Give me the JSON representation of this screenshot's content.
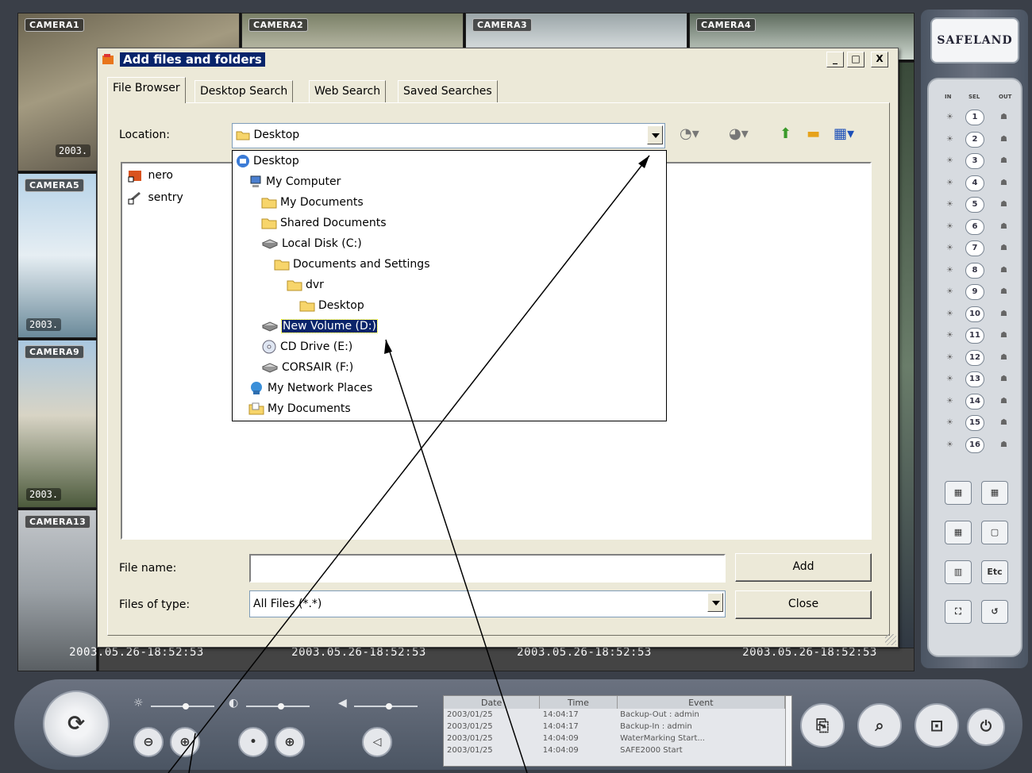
{
  "dvr": {
    "cameras": [
      {
        "label": "CAMERA1"
      },
      {
        "label": "CAMERA2"
      },
      {
        "label": "CAMERA3"
      },
      {
        "label": "CAMERA4"
      },
      {
        "label": "CAMERA5"
      },
      {
        "label": "CAMERA9"
      },
      {
        "label": "CAMERA13"
      }
    ],
    "left_stamps": [
      "2003.",
      "2003.",
      "2003."
    ],
    "timestamps": [
      "2003.05.26-18:52:53",
      "2003.05.26-18:52:53",
      "2003.05.26-18:52:53",
      "2003.05.26-18:52:53"
    ],
    "logo": "SAFELAND",
    "channels": {
      "header_in": "IN",
      "header_mid": "SEL",
      "header_out": "OUT",
      "numbers": [
        "1",
        "2",
        "3",
        "4",
        "5",
        "6",
        "7",
        "8",
        "9",
        "10",
        "11",
        "12",
        "13",
        "14",
        "15",
        "16"
      ]
    },
    "layout_buttons": [
      "",
      "",
      "",
      "",
      "",
      "Etc",
      "",
      ""
    ],
    "event_log": {
      "headers": [
        "Date",
        "Time",
        "Event"
      ],
      "rows": [
        [
          "2003/01/25",
          "14:04:17",
          "Backup-Out : admin"
        ],
        [
          "2003/01/25",
          "14:04:17",
          "Backup-In : admin"
        ],
        [
          "2003/01/25",
          "14:04:09",
          "WaterMarking Start..."
        ],
        [
          "2003/01/25",
          "14:04:09",
          "SAFE2000 Start"
        ]
      ]
    }
  },
  "dialog": {
    "title": "Add files and folders",
    "tabs": [
      "File Browser",
      "Desktop Search",
      "Web Search",
      "Saved Searches"
    ],
    "active_tab": "File Browser",
    "location_label": "Location:",
    "location_value": "Desktop",
    "files": [
      {
        "name": "nero",
        "icon": "nero-shortcut-icon"
      },
      {
        "name": "sentry",
        "icon": "sentry-shortcut-icon"
      }
    ],
    "dropdown_items": [
      {
        "label": "Desktop",
        "icon": "desktop-icon",
        "level": 0
      },
      {
        "label": "My Computer",
        "icon": "computer-icon",
        "level": 1
      },
      {
        "label": "My Documents",
        "icon": "folder-icon",
        "level": 2
      },
      {
        "label": "Shared Documents",
        "icon": "folder-icon",
        "level": 2
      },
      {
        "label": "Local Disk (C:)",
        "icon": "hard-drive-icon",
        "level": 2
      },
      {
        "label": "Documents and Settings",
        "icon": "folder-icon",
        "level": 3
      },
      {
        "label": "dvr",
        "icon": "folder-icon",
        "level": 4
      },
      {
        "label": "Desktop",
        "icon": "folder-icon",
        "level": 5
      },
      {
        "label": "New Volume (D:)",
        "icon": "hard-drive-icon",
        "level": 2,
        "selected": true
      },
      {
        "label": "CD Drive (E:)",
        "icon": "cd-drive-icon",
        "level": 2
      },
      {
        "label": "CORSAIR (F:)",
        "icon": "removable-drive-icon",
        "level": 2
      },
      {
        "label": "My Network Places",
        "icon": "network-places-icon",
        "level": 1
      },
      {
        "label": "My Documents",
        "icon": "my-documents-icon",
        "level": 1
      }
    ],
    "file_name_label": "File name:",
    "file_name_value": "",
    "files_of_type_label": "Files of type:",
    "files_of_type_value": "All Files (*.*)",
    "add_button": "Add",
    "close_button": "Close",
    "window_buttons": {
      "minimize": "_",
      "maximize": "□",
      "close": "X"
    }
  },
  "colors": {
    "selection": "#0a246a",
    "dialog_face": "#ece9d8",
    "title_highlight": "#08246b"
  }
}
